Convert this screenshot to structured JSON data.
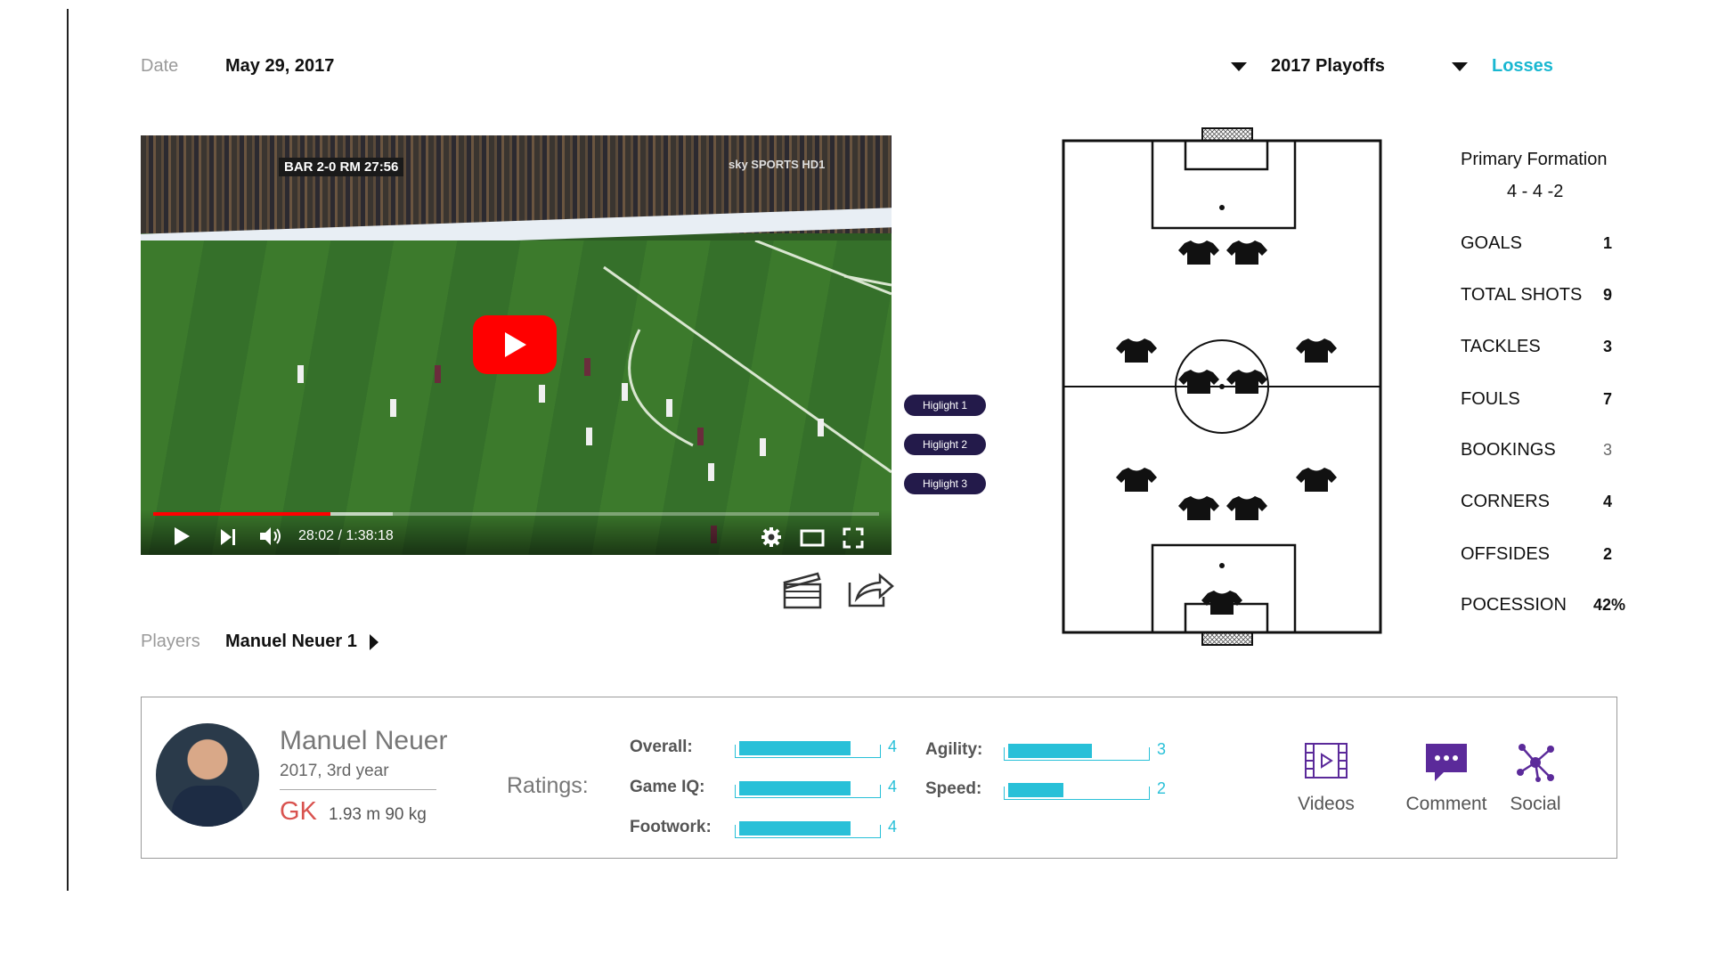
{
  "header": {
    "date_label": "Date",
    "date_value": "May 29, 2017",
    "season_filter": "2017 Playoffs",
    "result_filter": "Losses",
    "result_color": "#19b7d1"
  },
  "video": {
    "scorebug": "BAR 2-0 RM 27:56",
    "broadcaster": "sky SPORTS HD1",
    "time": "28:02 / 1:38:18",
    "played_fraction": 0.244,
    "buffered_fraction": 0.33
  },
  "highlights": [
    "Higlight 1",
    "Higlight 2",
    "Higlight 3"
  ],
  "players": {
    "label": "Players",
    "selected": "Manuel Neuer 1"
  },
  "stats": {
    "formation_label": "Primary Formation",
    "formation_value": "4 - 4 -2",
    "rows": [
      {
        "label": "GOALS",
        "value": "1"
      },
      {
        "label": "TOTAL SHOTS",
        "value": "9"
      },
      {
        "label": "TACKLES",
        "value": "3"
      },
      {
        "label": "FOULS",
        "value": "7"
      },
      {
        "label": "BOOKINGS",
        "value": "3"
      },
      {
        "label": "CORNERS",
        "value": "4"
      },
      {
        "label": "OFFSIDES",
        "value": "2"
      },
      {
        "label": "POCESSION",
        "value": "42%"
      }
    ]
  },
  "player_card": {
    "name": "Manuel Neuer",
    "season": "2017, 3rd year",
    "position": "GK",
    "position_color": "#d9534f",
    "measurements": "1.93 m 90 kg",
    "ratings_label": "Ratings:",
    "ratings": [
      {
        "label": "Overall:",
        "value": "4",
        "fraction": 0.77
      },
      {
        "label": "Game IQ:",
        "value": "4",
        "fraction": 0.77
      },
      {
        "label": "Footwork:",
        "value": "4",
        "fraction": 0.77
      },
      {
        "label": "Agility:",
        "value": "3",
        "fraction": 0.58
      },
      {
        "label": "Speed:",
        "value": "2",
        "fraction": 0.38
      }
    ],
    "bar_color": "#28c0d8",
    "actions": [
      {
        "label": "Videos",
        "icon": "film-icon"
      },
      {
        "label": "Comment",
        "icon": "comment-icon"
      },
      {
        "label": "Social",
        "icon": "network-icon"
      }
    ],
    "accent_color": "#5b2a9a"
  }
}
